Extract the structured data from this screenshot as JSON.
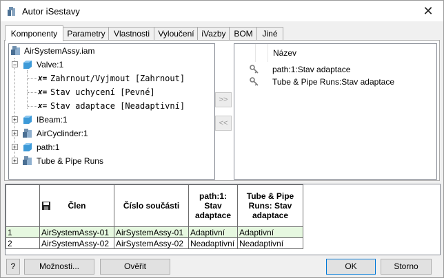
{
  "window": {
    "title": "Autor iSestavy",
    "close_glyph": "✕"
  },
  "tabs": [
    "Komponenty",
    "Parametry",
    "Vlastnosti",
    "Vyloučení",
    "iVazby",
    "BOM",
    "Jiné"
  ],
  "tree": {
    "root": "AirSystemAssy.iam",
    "valve": "Valve:1",
    "valve_params": [
      "Zahrnout/Vyjmout [Zahrnout]",
      "Stav uchycení [Pevné]",
      "Stav adaptace [Neadaptivní]"
    ],
    "x_glyph": "x=",
    "children": [
      "IBeam:1",
      "AirCyclinder:1",
      "path:1",
      "Tube & Pipe Runs"
    ],
    "plus": "+",
    "minus": "−"
  },
  "transfer": {
    "add": ">>",
    "remove": "<<"
  },
  "right_list": {
    "header": "Název",
    "items": [
      "path:1:Stav adaptace",
      "Tube & Pipe Runs:Stav adaptace"
    ]
  },
  "grid": {
    "headers": {
      "member": "Člen",
      "part_number": "Číslo součásti",
      "col3": "path:1: Stav adaptace",
      "col4": "Tube & Pipe Runs: Stav adaptace"
    },
    "rows": [
      {
        "num": "1",
        "member": "AirSystemAssy-01",
        "part": "AirSystemAssy-01",
        "c3": "Adaptivní",
        "c4": "Adaptivní"
      },
      {
        "num": "2",
        "member": "AirSystemAssy-02",
        "part": "AirSystemAssy-02",
        "c3": "Neadaptivní",
        "c4": "Neadaptivní"
      }
    ]
  },
  "buttons": {
    "help": "?",
    "options": "Možnosti...",
    "verify": "Ověřit",
    "ok": "OK",
    "cancel": "Storno"
  },
  "colors": {
    "selected_row": "#e6f8e0",
    "part_blue": "#3d9ad8",
    "accent": "#0078d7"
  }
}
